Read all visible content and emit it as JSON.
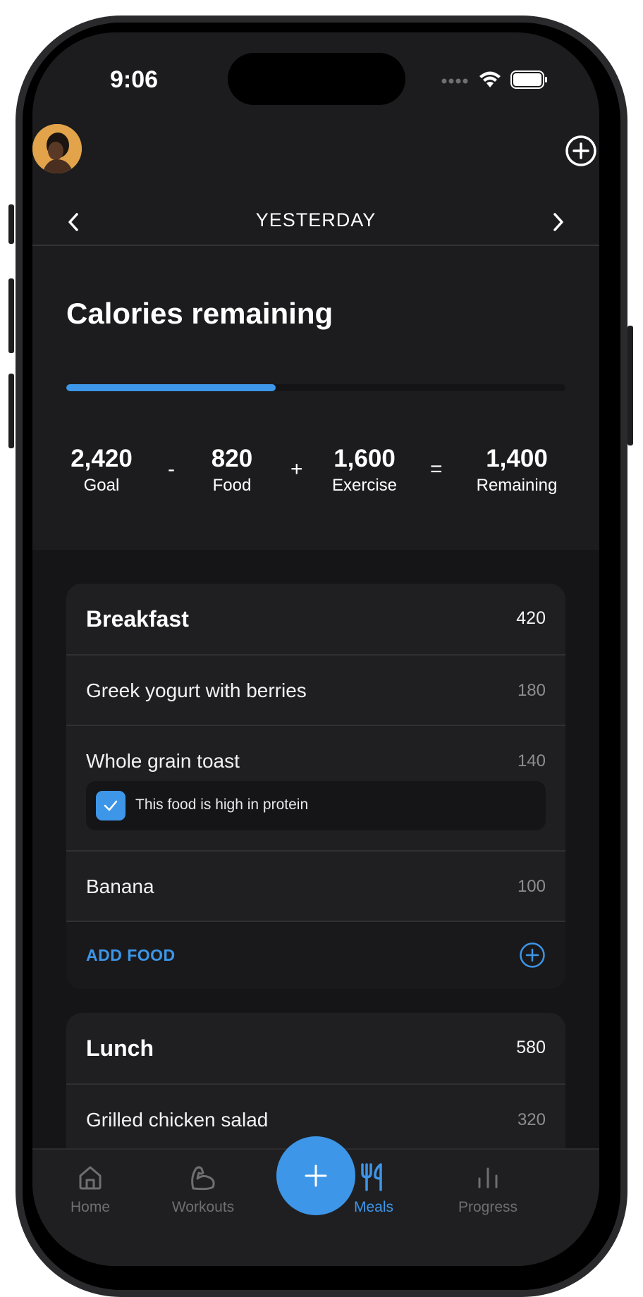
{
  "status_bar": {
    "time": "9:06"
  },
  "header": {
    "avatar_icon": "avatar",
    "add_icon": "plus-circle-icon"
  },
  "date_nav": {
    "label": "YESTERDAY",
    "prev_icon": "chevron-left-icon",
    "next_icon": "chevron-right-icon"
  },
  "calories": {
    "title": "Calories remaining",
    "progress_fraction": 0.42,
    "goal": {
      "value": "2,420",
      "label": "Goal"
    },
    "food": {
      "value": "820",
      "label": "Food"
    },
    "exercise": {
      "value": "1,600",
      "label": "Exercise"
    },
    "remaining": {
      "value": "1,400",
      "label": "Remaining"
    },
    "ops": {
      "minus": "-",
      "plus": "+",
      "equals": "="
    }
  },
  "meals": {
    "breakfast": {
      "name": "Breakfast",
      "calories": "420",
      "items": [
        {
          "name": "Greek yogurt with berries",
          "calories": "180"
        },
        {
          "name": "Whole grain toast",
          "calories": "140",
          "note": "This food is high in protein",
          "note_checked": true
        },
        {
          "name": "Banana",
          "calories": "100"
        }
      ],
      "add_label": "ADD FOOD"
    },
    "lunch": {
      "name": "Lunch",
      "calories": "580",
      "items": [
        {
          "name": "Grilled chicken salad",
          "calories": "320"
        }
      ]
    }
  },
  "tabbar": {
    "tabs": [
      {
        "label": "Home",
        "icon": "home-icon",
        "active": false
      },
      {
        "label": "Workouts",
        "icon": "muscle-icon",
        "active": false
      },
      {
        "label": "Meals",
        "icon": "fork-knife-icon",
        "active": true
      },
      {
        "label": "Progress",
        "icon": "bar-chart-icon",
        "active": false
      }
    ],
    "fab_icon": "plus-icon"
  },
  "colors": {
    "accent": "#3d96e8",
    "background": "#1c1c1e",
    "card": "#1f1f21"
  }
}
